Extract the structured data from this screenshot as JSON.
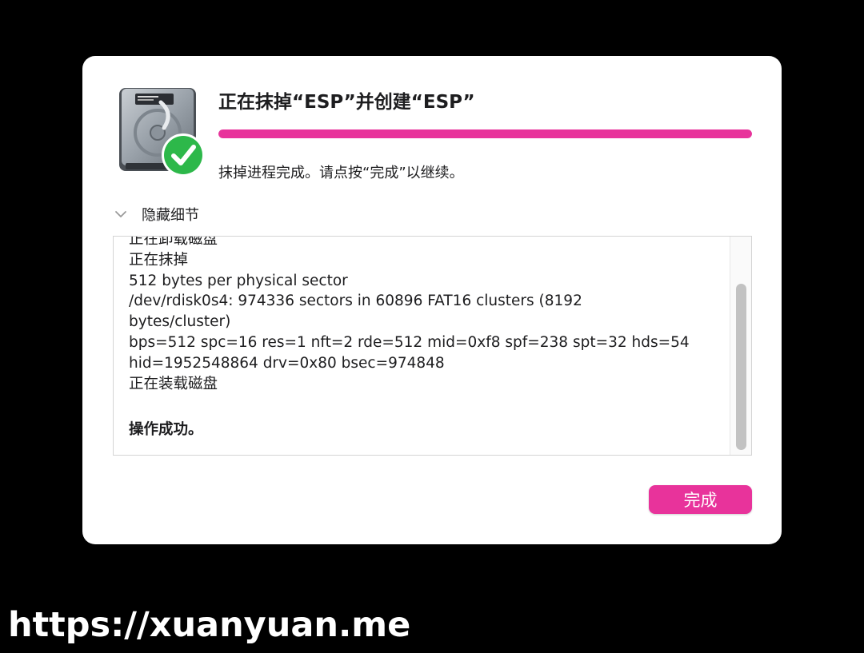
{
  "dialog": {
    "title": "正在抹掉“ESP”并创建“ESP”",
    "progress": 1.0,
    "status_text": "抹掉进程完成。请点按“完成”以继续。",
    "details_toggle_label": "隐藏细节",
    "log_lines": [
      "正在卸载磁盘",
      "正在抹掉",
      "512 bytes per physical sector",
      "/dev/rdisk0s4: 974336 sectors in 60896 FAT16 clusters (8192",
      "bytes/cluster)",
      "bps=512 spc=16 res=1 nft=2 rde=512 mid=0xf8 spf=238 spt=32 hds=54",
      "hid=1952548864 drv=0x80 bsec=974848",
      "正在装载磁盘",
      "",
      "操作成功。"
    ],
    "done_button_label": "完成"
  },
  "colors": {
    "accent": "#e8339b",
    "success": "#2db84a"
  },
  "icons": {
    "disk": "hard-drive-icon",
    "badge": "checkmark-badge-icon",
    "chevron": "chevron-down-icon"
  },
  "watermark": "https://xuanyuan.me"
}
